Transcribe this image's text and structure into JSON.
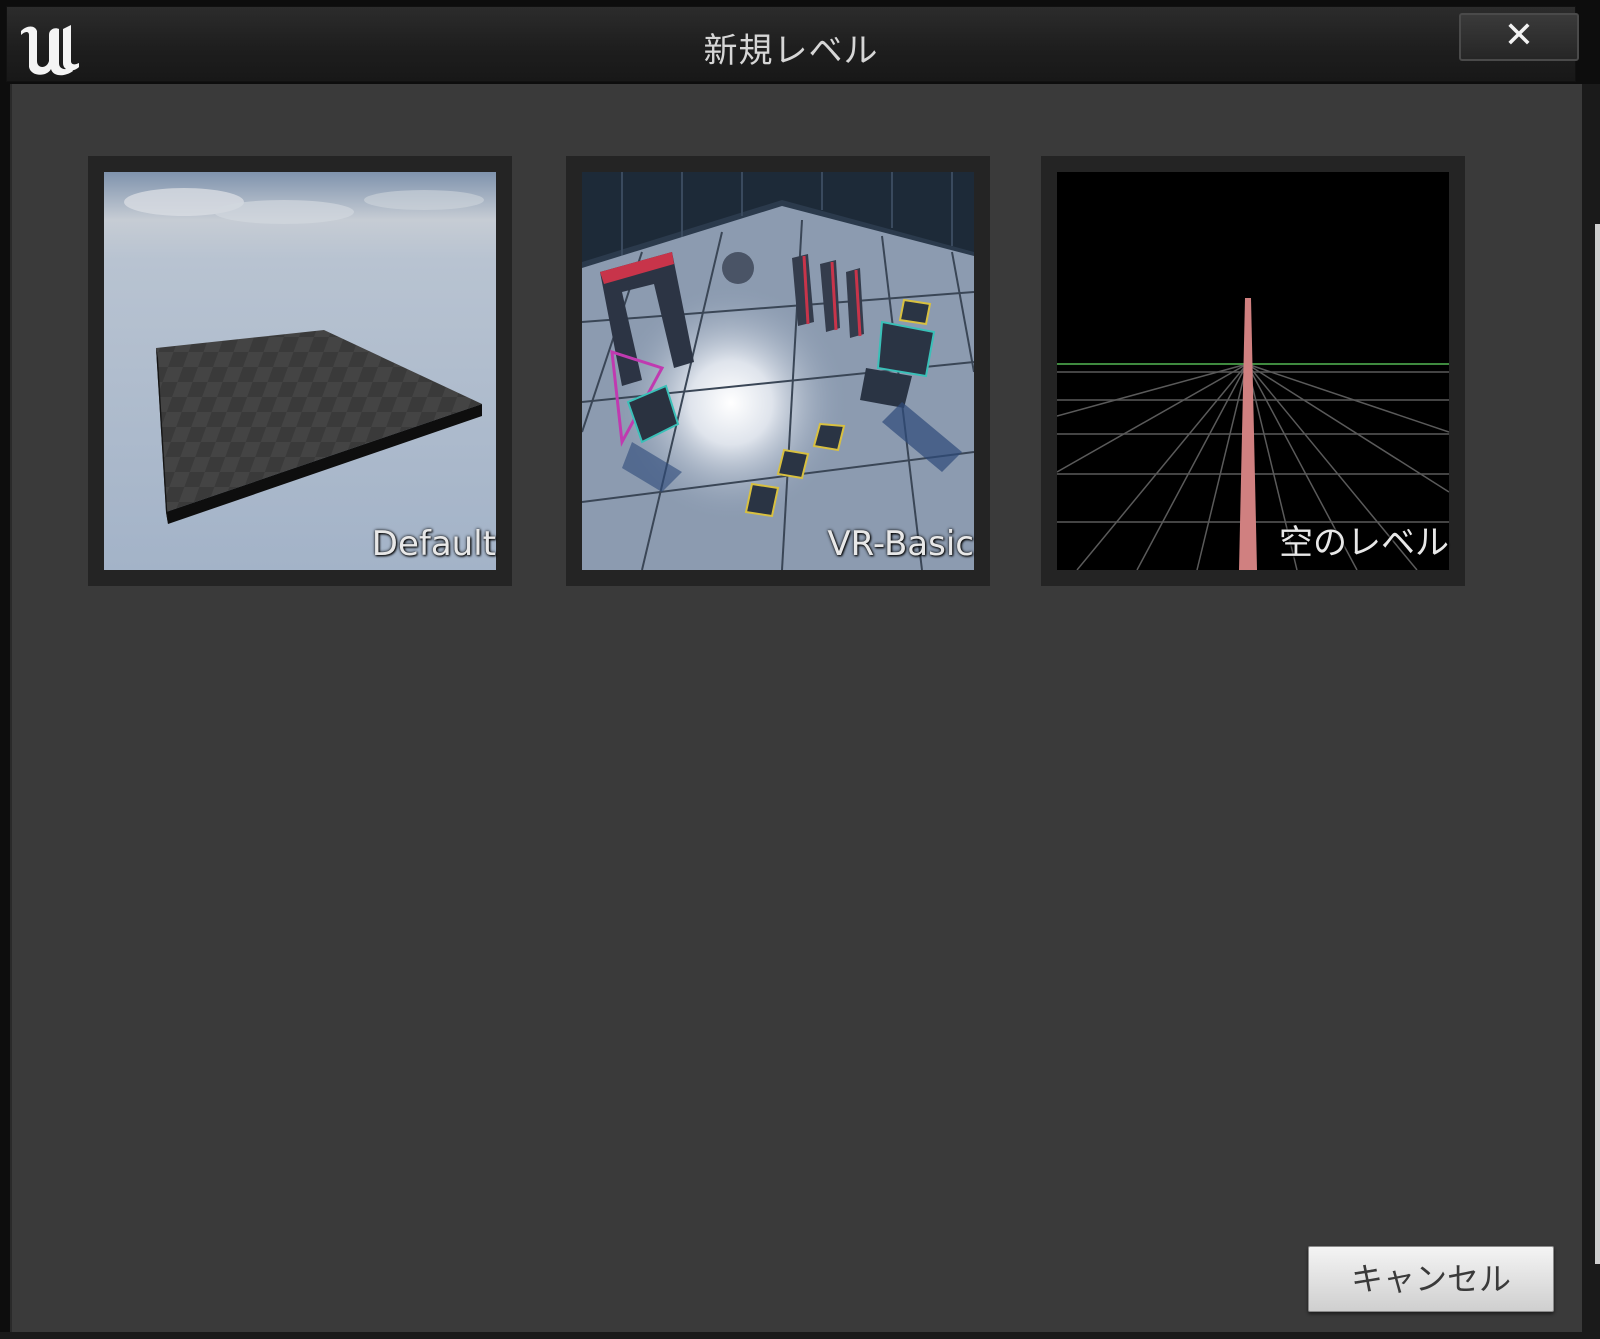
{
  "window": {
    "title": "新規レベル",
    "close_label": "✕",
    "logo_icon": "unreal-logo-icon"
  },
  "templates": [
    {
      "label": "Default"
    },
    {
      "label": "VR-Basic"
    },
    {
      "label": "空のレベル"
    }
  ],
  "actions": {
    "cancel_label": "キャンセル"
  }
}
